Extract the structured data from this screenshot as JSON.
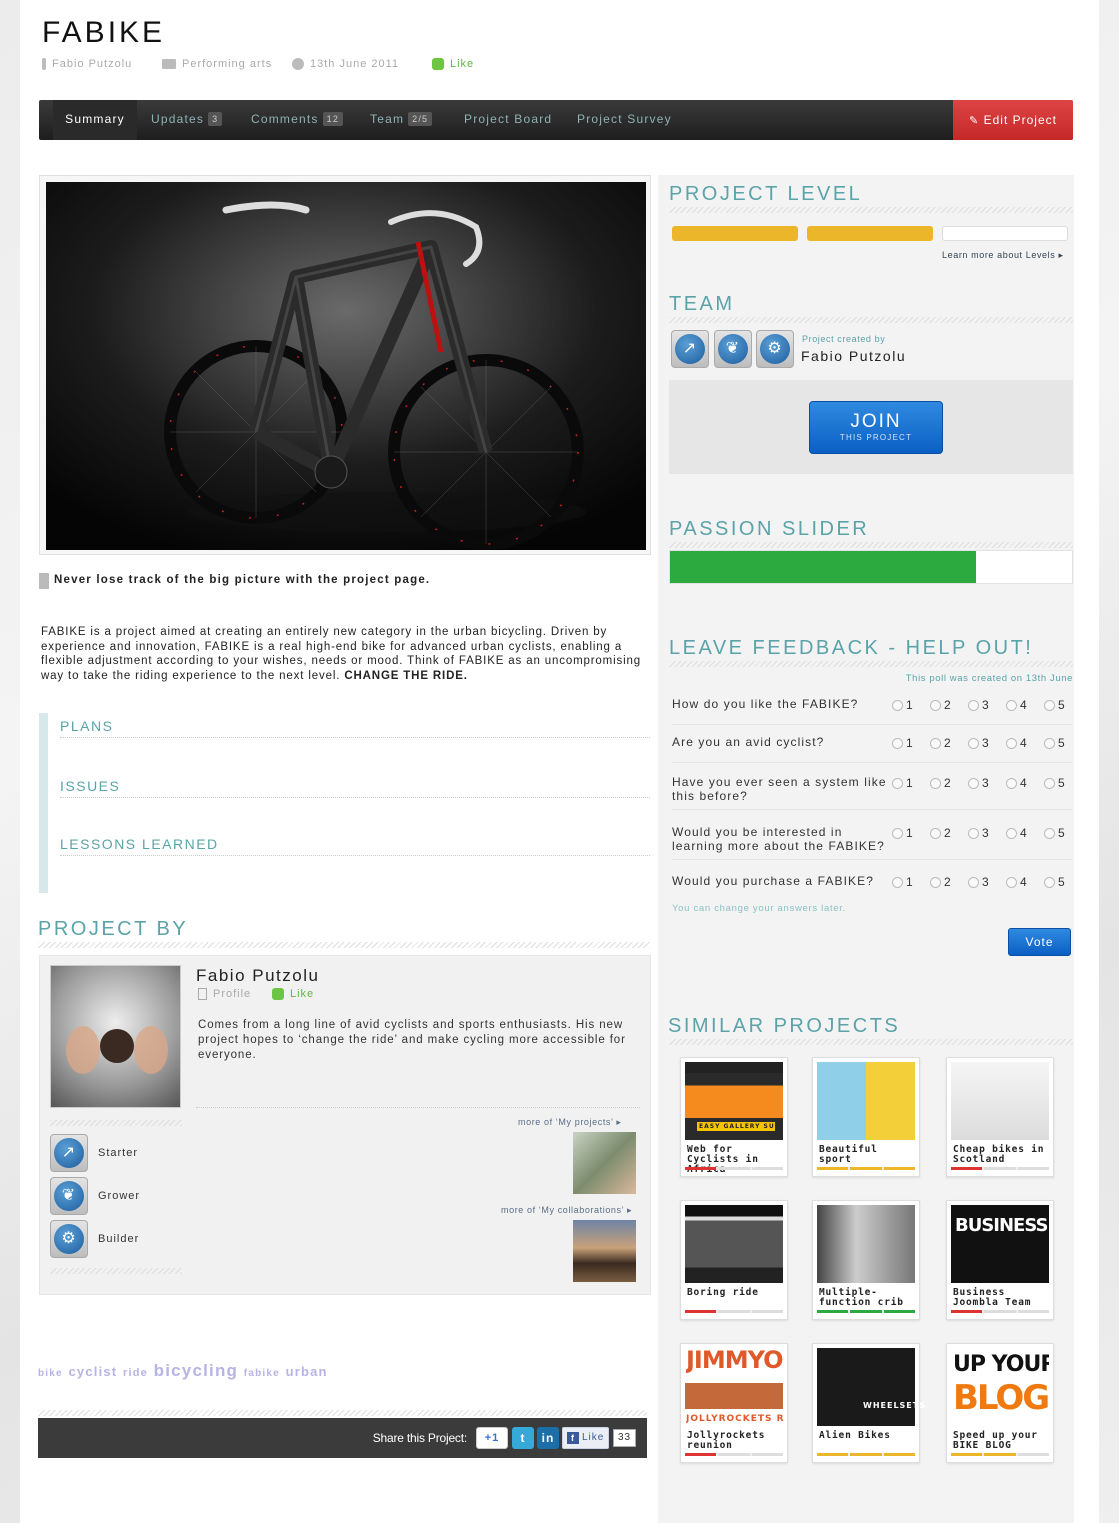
{
  "project": {
    "title": "FABIKE",
    "author": "Fabio Putzolu",
    "category": "Performing arts",
    "date": "13th June 2011",
    "like": "Like"
  },
  "nav": {
    "tabs": [
      {
        "label": "Summary"
      },
      {
        "label": "Updates",
        "badge": "3"
      },
      {
        "label": "Comments",
        "badge": "12"
      },
      {
        "label": "Team",
        "badge": "2/5"
      },
      {
        "label": "Project Board"
      },
      {
        "label": "Project Survey"
      }
    ],
    "edit": "Edit Project"
  },
  "main": {
    "caption": "Never lose track of the big picture with the project page.",
    "description": "FABIKE is a project aimed at creating an entirely new category in the urban bicycling. Driven by experience and innovation, FABIKE is a real high-end bike for advanced urban cyclists, enabling a flexible adjustment according to your wishes, needs or mood. Think of FABIKE as an uncompromising way to take the riding experience to the next level.",
    "description_bold": "CHANGE THE RIDE.",
    "sections": [
      "PLANS",
      "ISSUES",
      "LESSONS LEARNED"
    ]
  },
  "project_by": {
    "heading": "PROJECT BY",
    "name": "Fabio Putzolu",
    "profile": "Profile",
    "like": "Like",
    "bio": "Comes from a long line of avid cyclists and sports enthusiasts. His new project hopes to ‘change the ride’ and make cycling more accessible for everyone.",
    "badges": [
      "Starter",
      "Grower",
      "Builder"
    ],
    "more_projects": "more of ‘My projects’",
    "more_collabs": "more of ‘My collaborations’"
  },
  "tags": [
    "bike",
    "cyclist",
    "ride",
    "bicycling",
    "fabike",
    "urban"
  ],
  "share": {
    "label": "Share this Project:",
    "gplus": "+1",
    "fb_like": "Like",
    "fb_count": "33"
  },
  "sidebar": {
    "level": {
      "heading": "PROJECT LEVEL",
      "filled": 2,
      "total": 3,
      "link": "Learn more about Levels"
    },
    "team": {
      "heading": "TEAM",
      "created_by": "Project created by",
      "name": "Fabio Putzolu",
      "join": "JOIN",
      "join_sub": "THIS PROJECT"
    },
    "passion": {
      "heading": "PASSION SLIDER",
      "value": 0.76
    },
    "feedback": {
      "heading": "LEAVE FEEDBACK - HELP OUT!",
      "created": "This poll was created on 13th June",
      "questions": [
        "How do you like the FABIKE?",
        "Are you an avid cyclist?",
        "Have you ever seen a system like this before?",
        "Would you be interested in learning more about the FABIKE?",
        "Would you purchase a FABIKE?"
      ],
      "options": [
        "1",
        "2",
        "3",
        "4",
        "5"
      ],
      "note": "You can change your answers later.",
      "vote": "Vote"
    },
    "similar": {
      "heading": "SIMILAR PROJECTS",
      "items": [
        {
          "title": "Web for Cyclists in Africa"
        },
        {
          "title": "Beautiful sport"
        },
        {
          "title": "Cheap bikes in Scotland"
        },
        {
          "title": "Boring ride"
        },
        {
          "title": "Multiple-function crib"
        },
        {
          "title": "Business Joombla Team"
        },
        {
          "title": "Jollyrockets reunion"
        },
        {
          "title": "Alien Bikes"
        },
        {
          "title": "Speed up your BIKE BLOG"
        }
      ],
      "thumb_texts": [
        "EASY GALLERY SUBMISSION",
        "BUSINESS JO",
        "JIMMYOH",
        "JOLLYROCKETS REUN",
        "WHEELSETS",
        "UP YOUR",
        "BLOG"
      ]
    }
  }
}
